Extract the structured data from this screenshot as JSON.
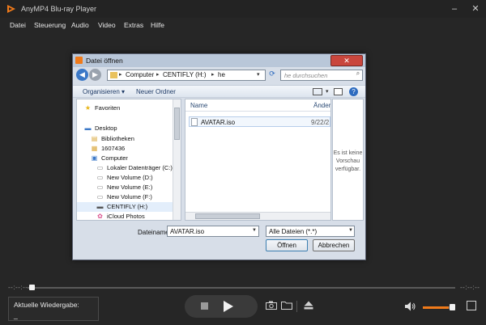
{
  "app": {
    "title": "AnyMP4 Blu-ray Player",
    "accent_color": "#f07a1a",
    "window_controls": [
      "minimize-icon",
      "close-icon"
    ]
  },
  "menu": [
    "Datei",
    "Steuerung",
    "Audio",
    "Video",
    "Extras",
    "Hilfe"
  ],
  "playback": {
    "time_elapsed": "--:--:--",
    "time_remaining": "--:--:--",
    "progress_fraction": 0.0,
    "now_playing_label": "Aktuelle Wiedergabe:",
    "now_playing_value": "_",
    "volume_fraction": 0.85,
    "icons": [
      "stop-icon",
      "play-icon",
      "snapshot-icon",
      "folder-icon",
      "eject-icon",
      "volume-icon",
      "fullscreen-icon"
    ]
  },
  "dialog": {
    "title": "Datei öffnen",
    "breadcrumbs": [
      "Computer",
      "CENTIFLY (H:)",
      "he"
    ],
    "search_placeholder": "he durchsuchen",
    "toolbar": {
      "organize": "Organisieren ▾",
      "new_folder": "Neuer Ordner"
    },
    "nav_items": [
      {
        "label": "Favoriten",
        "icon": "star-icon"
      },
      {
        "label": "Desktop",
        "icon": "desktop-icon"
      },
      {
        "label": "Bibliotheken",
        "icon": "library-icon"
      },
      {
        "label": "1607436",
        "icon": "user-folder-icon"
      },
      {
        "label": "Computer",
        "icon": "computer-icon"
      },
      {
        "label": "Lokaler Datenträger (C:)",
        "icon": "drive-icon"
      },
      {
        "label": "New Volume (D:)",
        "icon": "drive-icon"
      },
      {
        "label": "New Volume (E:)",
        "icon": "drive-icon"
      },
      {
        "label": "New Volume (F:)",
        "icon": "drive-icon"
      },
      {
        "label": "CENTIFLY (H:)",
        "icon": "usb-drive-icon"
      },
      {
        "label": "iCloud Photos",
        "icon": "icloud-icon"
      }
    ],
    "columns": {
      "name": "Name",
      "date": "Änder"
    },
    "files": [
      {
        "name": "AVATAR.iso",
        "date": "9/22/2"
      }
    ],
    "preview_text": "Es ist keine Vorschau verfügbar.",
    "filename_label": "Dateiname:",
    "filename_value": "AVATAR.iso",
    "filter_value": "Alle Dateien (*.*)",
    "open_button": "Öffnen",
    "cancel_button": "Abbrechen"
  }
}
